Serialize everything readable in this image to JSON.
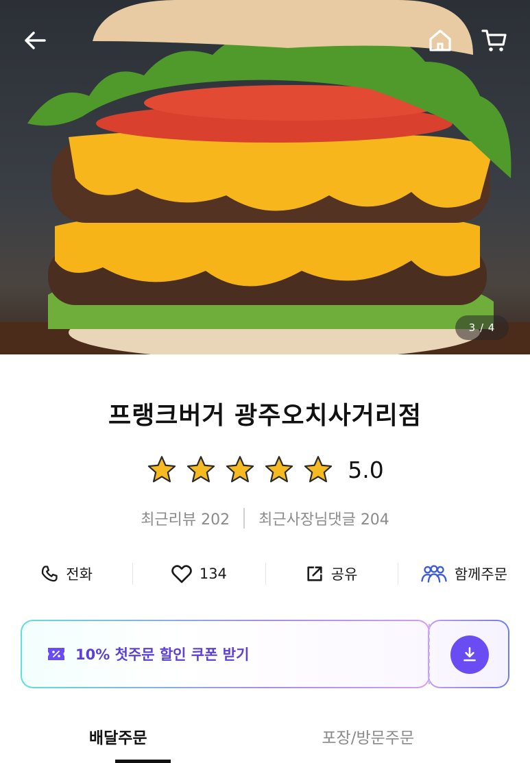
{
  "hero": {
    "image_label": "burger-photo",
    "counter": "3 / 4"
  },
  "nav": {
    "back_icon": "arrow-left-icon",
    "home_icon": "home-icon",
    "cart_icon": "cart-icon"
  },
  "store": {
    "name": "프랭크버거 광주오치사거리점",
    "rating": "5.0",
    "stars": 5,
    "recent_reviews_label": "최근리뷰 202",
    "recent_owner_replies_label": "최근사장님댓글 204"
  },
  "actions": [
    {
      "icon": "phone-icon",
      "label": "전화"
    },
    {
      "icon": "heart-icon",
      "label": "134"
    },
    {
      "icon": "share-icon",
      "label": "공유"
    },
    {
      "icon": "group-icon",
      "label": "함께주문"
    }
  ],
  "coupon": {
    "icon": "coupon-icon",
    "label": "10% 첫주문 할인 쿠폰 받기",
    "download_icon": "download-icon"
  },
  "tabs": [
    {
      "label": "배달주문",
      "active": true
    },
    {
      "label": "포장/방문주문",
      "active": false
    }
  ],
  "colors": {
    "accent": "#6a4df2",
    "coupon_text": "#5a3fd8",
    "star": "#f5b921",
    "group_icon": "#3b5bdb"
  }
}
